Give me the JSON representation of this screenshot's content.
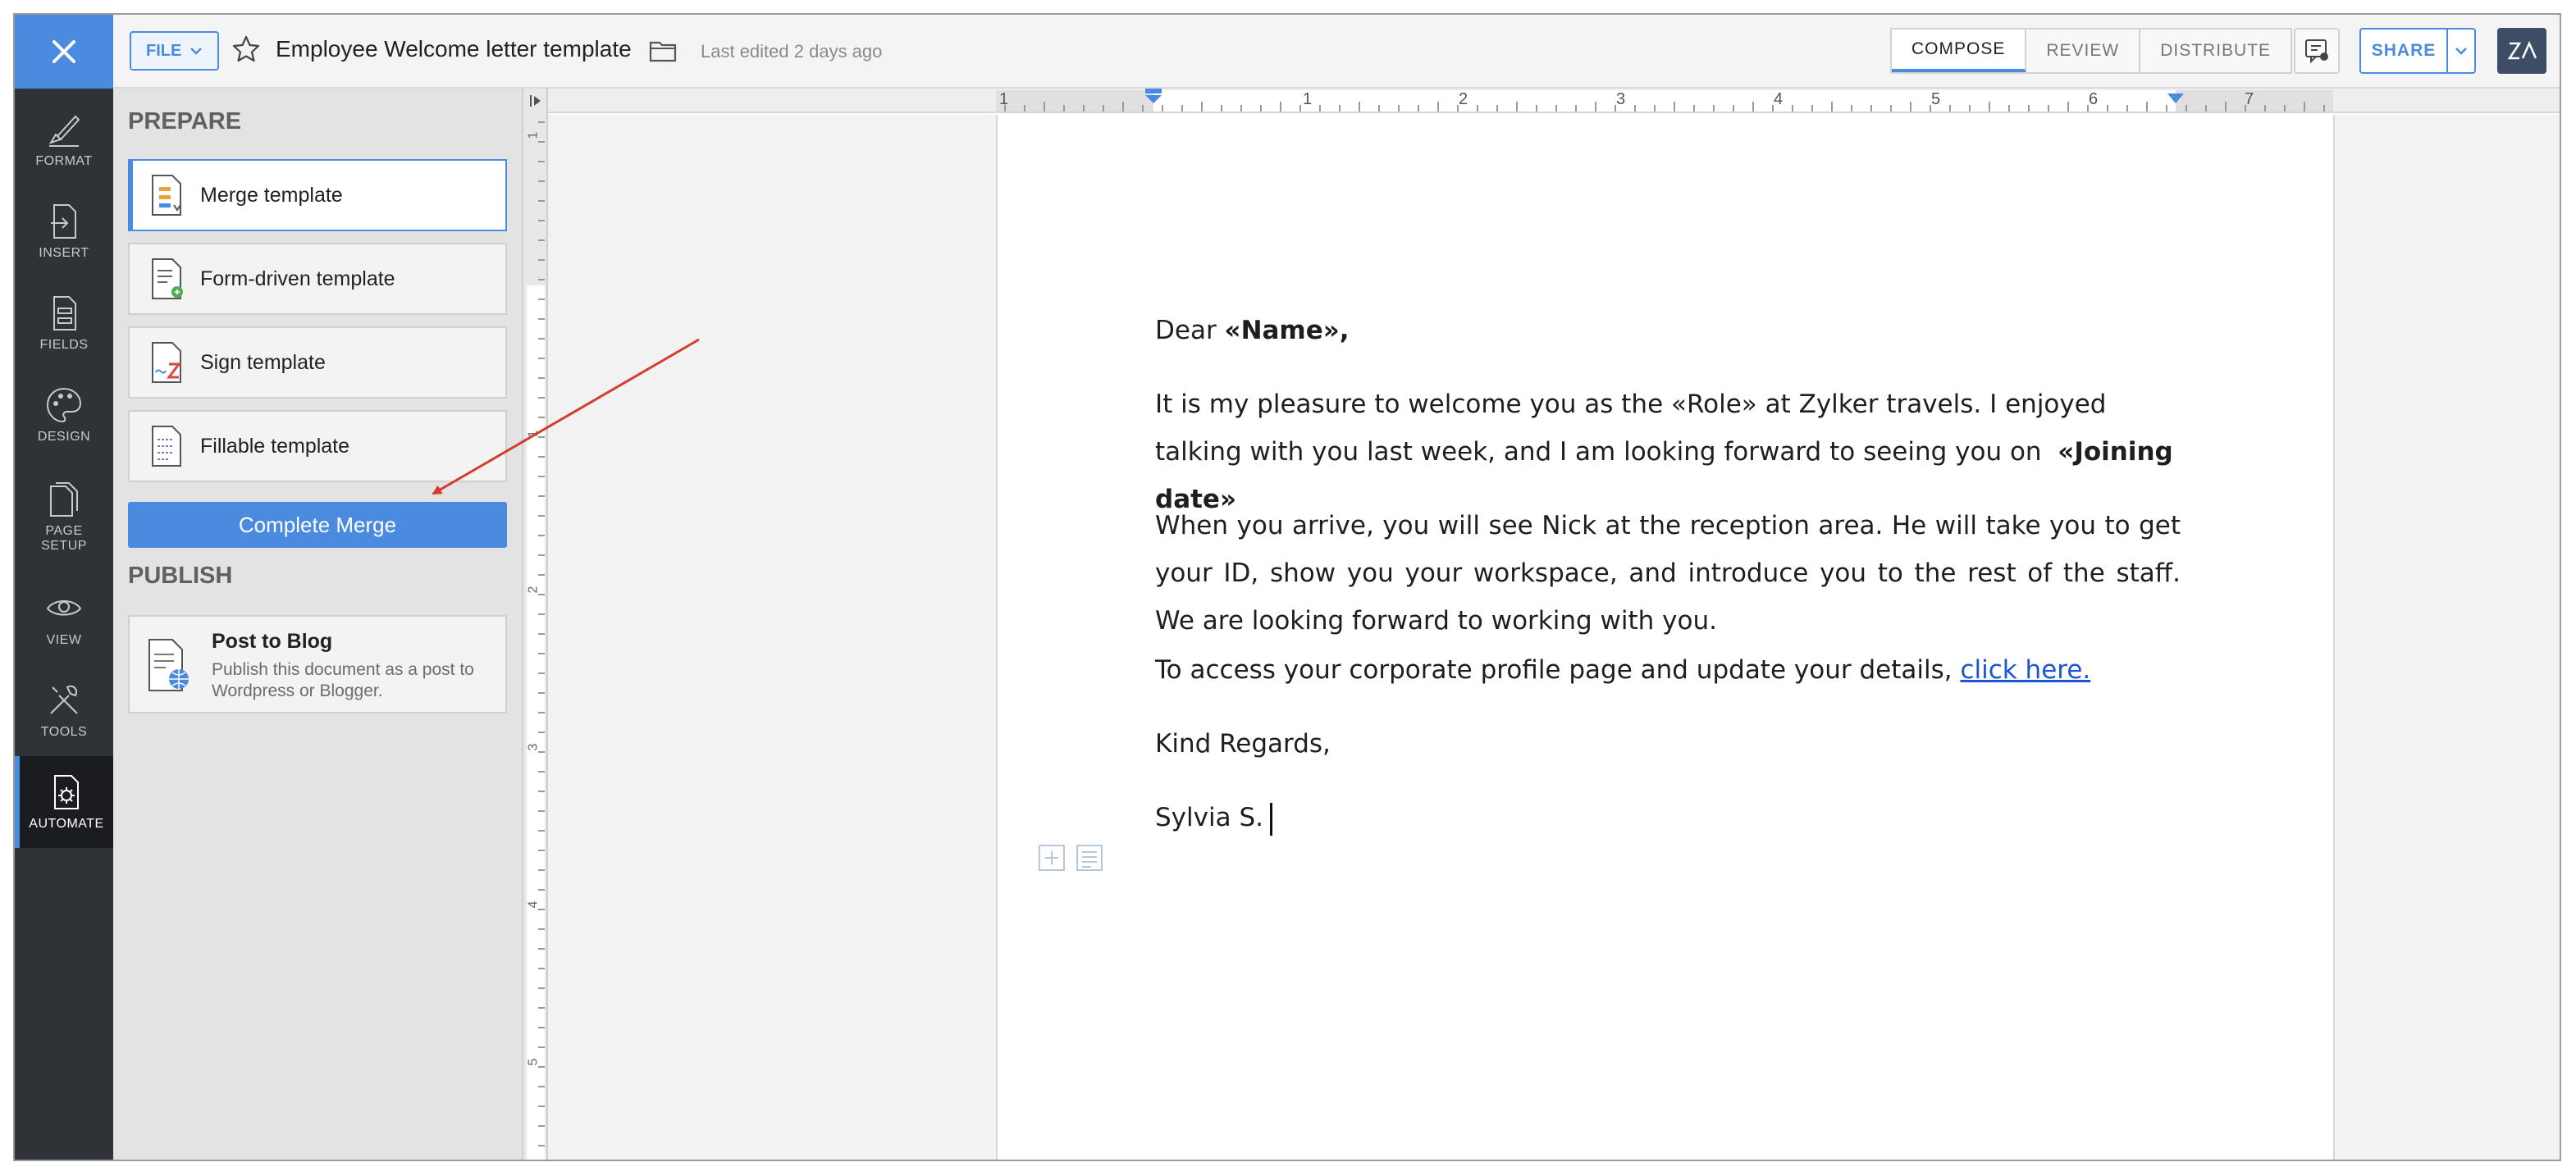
{
  "header": {
    "file_label": "FILE",
    "doc_title": "Employee Welcome letter template",
    "last_edited": "Last edited 2 days ago",
    "tabs": [
      {
        "label": "COMPOSE",
        "active": true
      },
      {
        "label": "REVIEW",
        "active": false
      },
      {
        "label": "DISTRIBUTE",
        "active": false
      }
    ],
    "share_label": "SHARE",
    "accent_color": "#4a8be0"
  },
  "rail": {
    "items": [
      {
        "label": "FORMAT",
        "icon": "brush-icon"
      },
      {
        "label": "INSERT",
        "icon": "insert-icon"
      },
      {
        "label": "FIELDS",
        "icon": "fields-icon"
      },
      {
        "label": "DESIGN",
        "icon": "palette-icon"
      },
      {
        "label": "PAGE\nSETUP",
        "icon": "page-setup-icon"
      },
      {
        "label": "VIEW",
        "icon": "eye-icon"
      },
      {
        "label": "TOOLS",
        "icon": "tools-icon"
      },
      {
        "label": "AUTOMATE",
        "icon": "automate-gear-icon",
        "active": true
      }
    ]
  },
  "panel": {
    "prepare_title": "PREPARE",
    "templates": [
      {
        "label": "Merge template",
        "icon": "merge-template-icon",
        "selected": true
      },
      {
        "label": "Form-driven template",
        "icon": "form-template-icon"
      },
      {
        "label": "Sign template",
        "icon": "sign-template-icon"
      },
      {
        "label": "Fillable template",
        "icon": "fillable-template-icon"
      }
    ],
    "complete_merge_label": "Complete Merge",
    "publish_title": "PUBLISH",
    "blog": {
      "title": "Post to Blog",
      "description": "Publish this document as a post to Wordpress or Blogger."
    }
  },
  "ruler": {
    "h_numbers": [
      "1",
      "1",
      "2",
      "3",
      "4",
      "5",
      "6",
      "7"
    ],
    "v_numbers": [
      "1",
      "1",
      "2",
      "3",
      "4",
      "5"
    ]
  },
  "letter": {
    "greeting_prefix": "Dear ",
    "greeting_field": "«Name»,",
    "p1_text": "It is my pleasure to welcome you as the «Role» at Zylker travels. I enjoyed talking with you last week, and I am looking forward to seeing you on ",
    "p1_field": "«Joining date»",
    "p2_text": "When you arrive, you will see Nick at the reception area. He will take you to get your ID, show you your workspace, and introduce you to the rest of the staff. We are looking forward to working with you.",
    "p3_text": "To access your corporate profile page and update your details, ",
    "p3_link": "click here.",
    "closing": "Kind Regards,",
    "signature": "Sylvia S."
  }
}
